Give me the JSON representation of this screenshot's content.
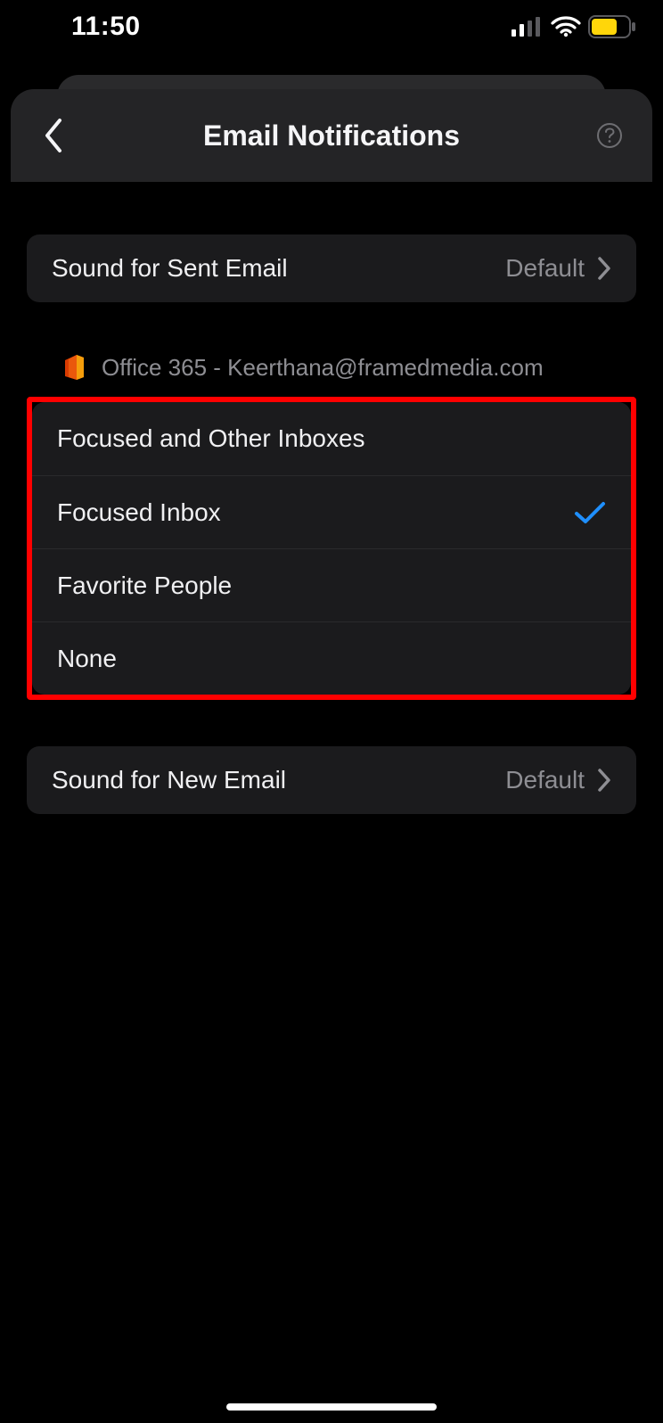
{
  "status_bar": {
    "time": "11:50"
  },
  "header": {
    "title": "Email Notifications"
  },
  "sound_sent": {
    "label": "Sound for Sent Email",
    "value": "Default"
  },
  "account": {
    "label": "Office 365 - Keerthana@framedmedia.com"
  },
  "options": {
    "focused_and_other": "Focused and Other Inboxes",
    "focused_inbox": "Focused Inbox",
    "favorite_people": "Favorite People",
    "none": "None",
    "selected_index": 1
  },
  "sound_new": {
    "label": "Sound for New Email",
    "value": "Default"
  }
}
